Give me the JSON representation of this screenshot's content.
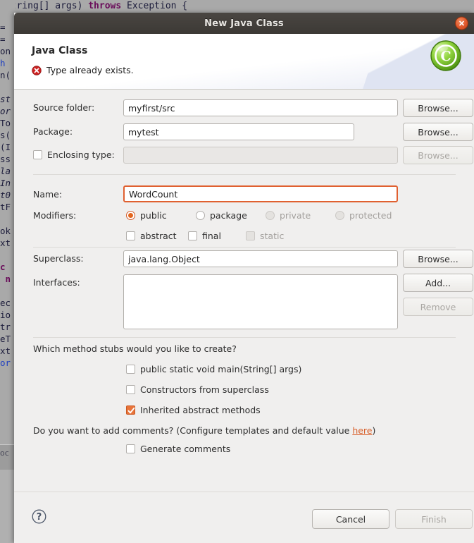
{
  "background": {
    "top_code_line": "(String[] args) throws Exception {",
    "code_fragments": [
      "=",
      "=",
      "on",
      "h",
      "n(",
      "",
      "st",
      "or",
      "To",
      "s(",
      "(I",
      "ss",
      "la",
      "In",
      "t0",
      "tF",
      "",
      "ok",
      "xt",
      "",
      "c",
      "n",
      "",
      "ec",
      "io",
      "tr",
      "eT",
      "xt",
      "or"
    ],
    "lower_panel_label": "oc"
  },
  "dialog": {
    "title": "New Java Class",
    "close_icon": "close-icon",
    "header": {
      "title": "Java Class",
      "message": "Type already exists.",
      "message_icon": "error-icon",
      "logo_icon": "java-class-icon"
    },
    "fields": {
      "source_folder": {
        "label": "Source folder:",
        "value": "myfirst/src",
        "browse_label": "Browse...",
        "enabled": true
      },
      "package": {
        "label": "Package:",
        "value": "mytest",
        "browse_label": "Browse...",
        "enabled": true
      },
      "enclosing_type": {
        "label": "Enclosing type:",
        "value": "",
        "browse_label": "Browse...",
        "checked": false,
        "enabled": false
      },
      "name": {
        "label": "Name:",
        "value": "WordCount",
        "error": true
      },
      "superclass": {
        "label": "Superclass:",
        "value": "java.lang.Object",
        "browse_label": "Browse...",
        "enabled": true
      },
      "interfaces": {
        "label": "Interfaces:",
        "items": [],
        "add_label": "Add...",
        "remove_label": "Remove",
        "remove_enabled": false
      }
    },
    "modifiers": {
      "label": "Modifiers:",
      "access": [
        {
          "label": "public",
          "checked": true,
          "enabled": true
        },
        {
          "label": "package",
          "checked": false,
          "enabled": true
        },
        {
          "label": "private",
          "checked": false,
          "enabled": false
        },
        {
          "label": "protected",
          "checked": false,
          "enabled": false
        }
      ],
      "other": [
        {
          "label": "abstract",
          "checked": false,
          "enabled": true
        },
        {
          "label": "final",
          "checked": false,
          "enabled": true
        },
        {
          "label": "static",
          "checked": false,
          "enabled": false
        }
      ]
    },
    "stubs": {
      "question": "Which method stubs would you like to create?",
      "options": [
        {
          "label": "public static void main(String[] args)",
          "checked": false
        },
        {
          "label": "Constructors from superclass",
          "checked": false
        },
        {
          "label": "Inherited abstract methods",
          "checked": true
        }
      ]
    },
    "comments": {
      "question_prefix": "Do you want to add comments? (Configure templates and default value ",
      "link_label": "here",
      "question_suffix": ")",
      "option": {
        "label": "Generate comments",
        "checked": false
      }
    },
    "footer": {
      "help_icon": "help-icon",
      "cancel_label": "Cancel",
      "finish_label": "Finish",
      "finish_enabled": false
    }
  },
  "colors": {
    "accent": "#e2661f",
    "error": "#cc2222",
    "link": "#d8602b",
    "titlebar": "#3c3935",
    "dialog_bg": "#f0efee"
  }
}
